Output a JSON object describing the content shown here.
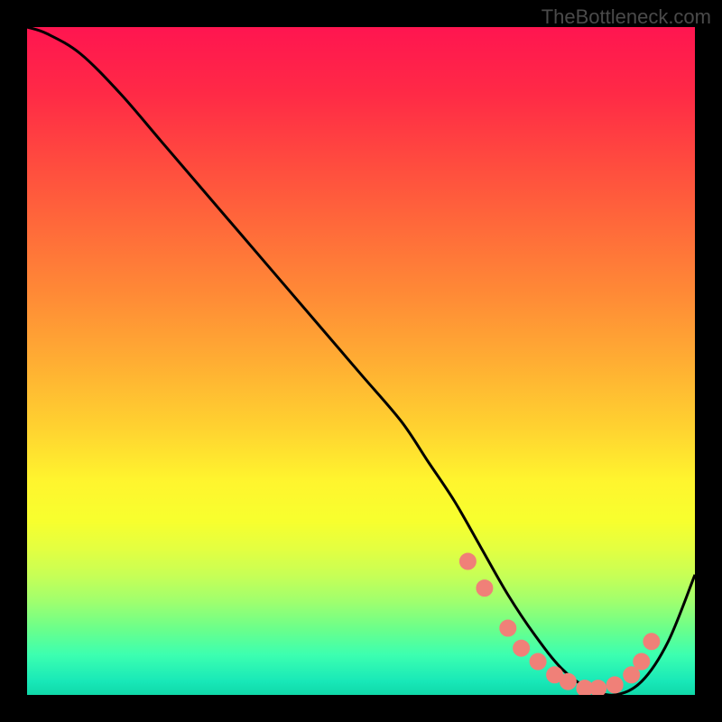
{
  "watermark": "TheBottleneck.com",
  "colors": {
    "bg": "#000000",
    "gradient_stops": [
      {
        "offset": 0.0,
        "color": "#ff1550"
      },
      {
        "offset": 0.1,
        "color": "#ff2a46"
      },
      {
        "offset": 0.2,
        "color": "#ff4a3f"
      },
      {
        "offset": 0.3,
        "color": "#ff6a3a"
      },
      {
        "offset": 0.4,
        "color": "#ff8a36"
      },
      {
        "offset": 0.5,
        "color": "#ffad33"
      },
      {
        "offset": 0.6,
        "color": "#ffd230"
      },
      {
        "offset": 0.68,
        "color": "#fff52e"
      },
      {
        "offset": 0.74,
        "color": "#f7ff2e"
      },
      {
        "offset": 0.78,
        "color": "#e4ff40"
      },
      {
        "offset": 0.82,
        "color": "#c8ff55"
      },
      {
        "offset": 0.86,
        "color": "#a0ff6e"
      },
      {
        "offset": 0.9,
        "color": "#6cff8a"
      },
      {
        "offset": 0.94,
        "color": "#3cffb0"
      },
      {
        "offset": 0.98,
        "color": "#18e8b8"
      },
      {
        "offset": 1.0,
        "color": "#10d8a8"
      }
    ],
    "curve": "#000000",
    "point_fill": "#f08078",
    "point_stroke": "#f08078"
  },
  "chart_data": {
    "type": "line",
    "title": "",
    "xlabel": "",
    "ylabel": "",
    "xlim": [
      0,
      100
    ],
    "ylim": [
      0,
      100
    ],
    "series": [
      {
        "name": "curve",
        "x": [
          0,
          3,
          8,
          14,
          20,
          26,
          32,
          38,
          44,
          50,
          56,
          60,
          64,
          68,
          72,
          76,
          80,
          84,
          88,
          92,
          96,
          100
        ],
        "y": [
          100,
          99,
          96,
          90,
          83,
          76,
          69,
          62,
          55,
          48,
          41,
          35,
          29,
          22,
          15,
          9,
          4,
          1,
          0,
          2,
          8,
          18
        ]
      }
    ],
    "points": {
      "name": "markers",
      "x": [
        66,
        68.5,
        72,
        74,
        76.5,
        79,
        81,
        83.5,
        85.5,
        88,
        90.5,
        92,
        93.5
      ],
      "y": [
        20,
        16,
        10,
        7,
        5,
        3,
        2,
        1,
        1,
        1.5,
        3,
        5,
        8
      ]
    }
  }
}
